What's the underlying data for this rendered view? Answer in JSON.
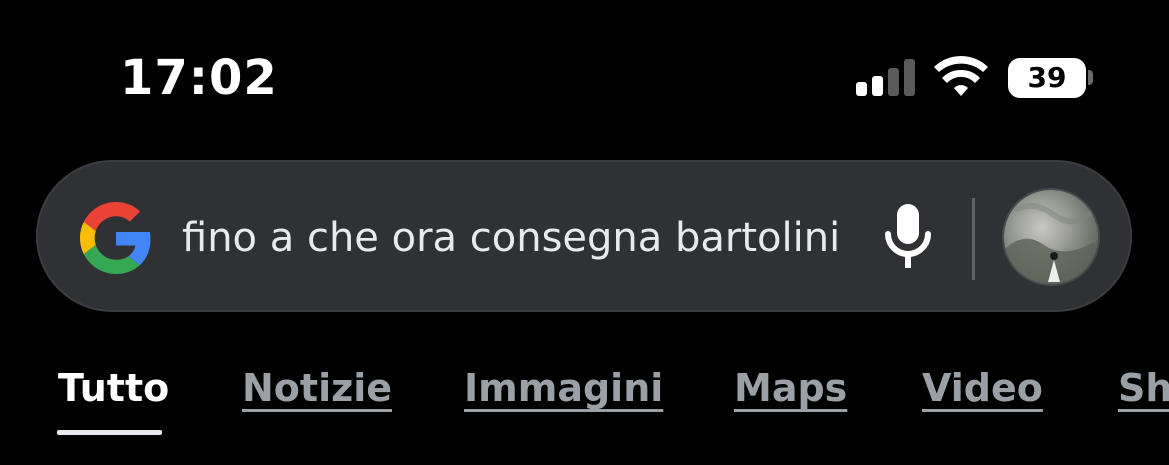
{
  "status_bar": {
    "time": "17:02",
    "battery_level": "39",
    "signal_bars_active": 2,
    "signal_bars_total": 4
  },
  "search": {
    "query": "fino a che ora consegna bartolini",
    "logo_icon": "google-g-icon",
    "mic_icon": "microphone-icon",
    "avatar_icon": "profile-avatar"
  },
  "tabs": [
    {
      "label": "Tutto",
      "active": true
    },
    {
      "label": "Notizie",
      "active": false
    },
    {
      "label": "Immagini",
      "active": false
    },
    {
      "label": "Maps",
      "active": false
    },
    {
      "label": "Video",
      "active": false
    },
    {
      "label": "Sh",
      "active": false
    }
  ],
  "colors": {
    "background": "#000000",
    "search_box": "#303134",
    "tab_inactive": "#9aa0a6",
    "tab_active": "#ffffff",
    "google_blue": "#4285F4",
    "google_red": "#EA4335",
    "google_yellow": "#FBBC05",
    "google_green": "#34A853"
  }
}
